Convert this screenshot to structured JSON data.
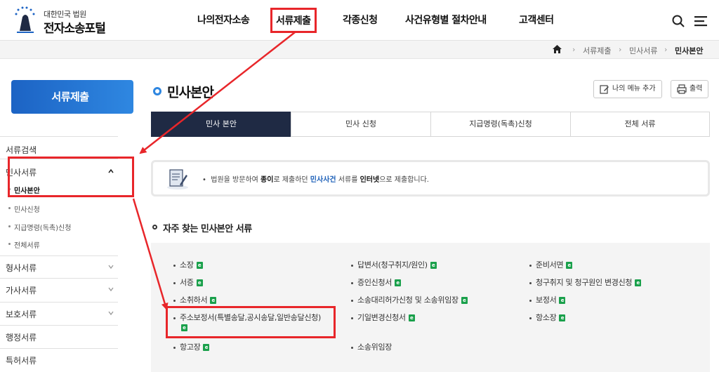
{
  "logo": {
    "sub": "대한민국 법원",
    "main": "전자소송포털"
  },
  "gnb": [
    {
      "label": "나의전자소송",
      "highlight": false
    },
    {
      "label": "서류제출",
      "highlight": true
    },
    {
      "label": "각종신청",
      "highlight": false
    },
    {
      "label": "사건유형별 절차안내",
      "highlight": false
    },
    {
      "label": "고객센터",
      "highlight": false
    }
  ],
  "breadcrumb": [
    "서류제출",
    "민사서류",
    "민사본안"
  ],
  "sidebar": {
    "title": "서류제출",
    "items": [
      {
        "label": "서류검색"
      },
      {
        "label": "민사서류",
        "expanded": true
      },
      {
        "label": "형사서류"
      },
      {
        "label": "가사서류"
      },
      {
        "label": "보호서류"
      },
      {
        "label": "행정서류"
      },
      {
        "label": "특허서류"
      }
    ],
    "subitems": [
      {
        "label": "민사본안",
        "active": true
      },
      {
        "label": "민사신청"
      },
      {
        "label": "지급명령(독촉)신청"
      },
      {
        "label": "전체서류"
      }
    ]
  },
  "main": {
    "title": "민사본안",
    "buttons": {
      "menu_add": "나의 메뉴 추가",
      "print": "출력"
    },
    "tabs": [
      "민사 본안",
      "민사 신청",
      "지급명령(독촉)신청",
      "전체 서류"
    ],
    "notice": {
      "p1": "법원을 방문하여 ",
      "b1": "종이",
      "p2": "로 제출하던 ",
      "b2": "민사사건",
      "p3": " 서류를 ",
      "b3": "인터넷",
      "p4": "으로 제출합니다."
    },
    "section_title": "자주 찾는 민사본안 서류",
    "documents": [
      [
        "소장",
        "서증",
        "소취하서",
        "주소보정서(특별송달,공시송달,일반송달신청)",
        "항고장"
      ],
      [
        "답변서(청구취지/원인)",
        "증인신청서",
        "소송대리허가신청 및 소송위임장",
        "기일변경신청서",
        "소송위임장"
      ],
      [
        "준비서면",
        "청구취지 및 청구원인 변경신청",
        "보정서",
        "항소장"
      ]
    ],
    "e_label": "e"
  },
  "colors": {
    "accent": "#1c63c4",
    "highlight": "#e8262a",
    "tab_active": "#1f2a44",
    "e_icon": "#1aa04b"
  }
}
